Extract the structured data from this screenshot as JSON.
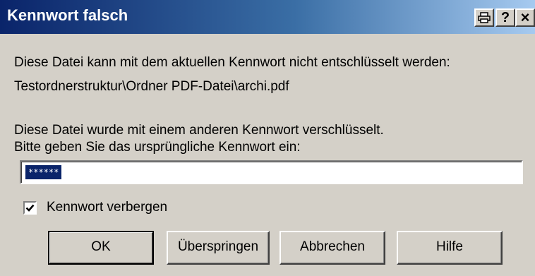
{
  "dialog": {
    "title": "Kennwort falsch",
    "title_buttons": {
      "print_icon": "printer-icon",
      "help": "?",
      "close": "×"
    },
    "message": {
      "line1": "Diese Datei kann mit dem aktuellen Kennwort nicht entschlüsselt werden:",
      "path": "Testordnerstruktur\\Ordner PDF-Datei\\archi.pdf",
      "line3": "Diese Datei wurde mit einem anderen Kennwort verschlüsselt.",
      "line4": "Bitte geben Sie das ursprüngliche Kennwort ein:"
    },
    "password_field": {
      "value": "******"
    },
    "hide_password": {
      "label": "Kennwort verbergen",
      "checked": true
    },
    "buttons": {
      "ok": "OK",
      "skip": "Überspringen",
      "cancel": "Abbrechen",
      "help": "Hilfe"
    }
  },
  "colors": {
    "titlebar_start": "#0a246a",
    "titlebar_end": "#a6caf0",
    "face": "#d4d0c8",
    "selection": "#0a246a"
  }
}
